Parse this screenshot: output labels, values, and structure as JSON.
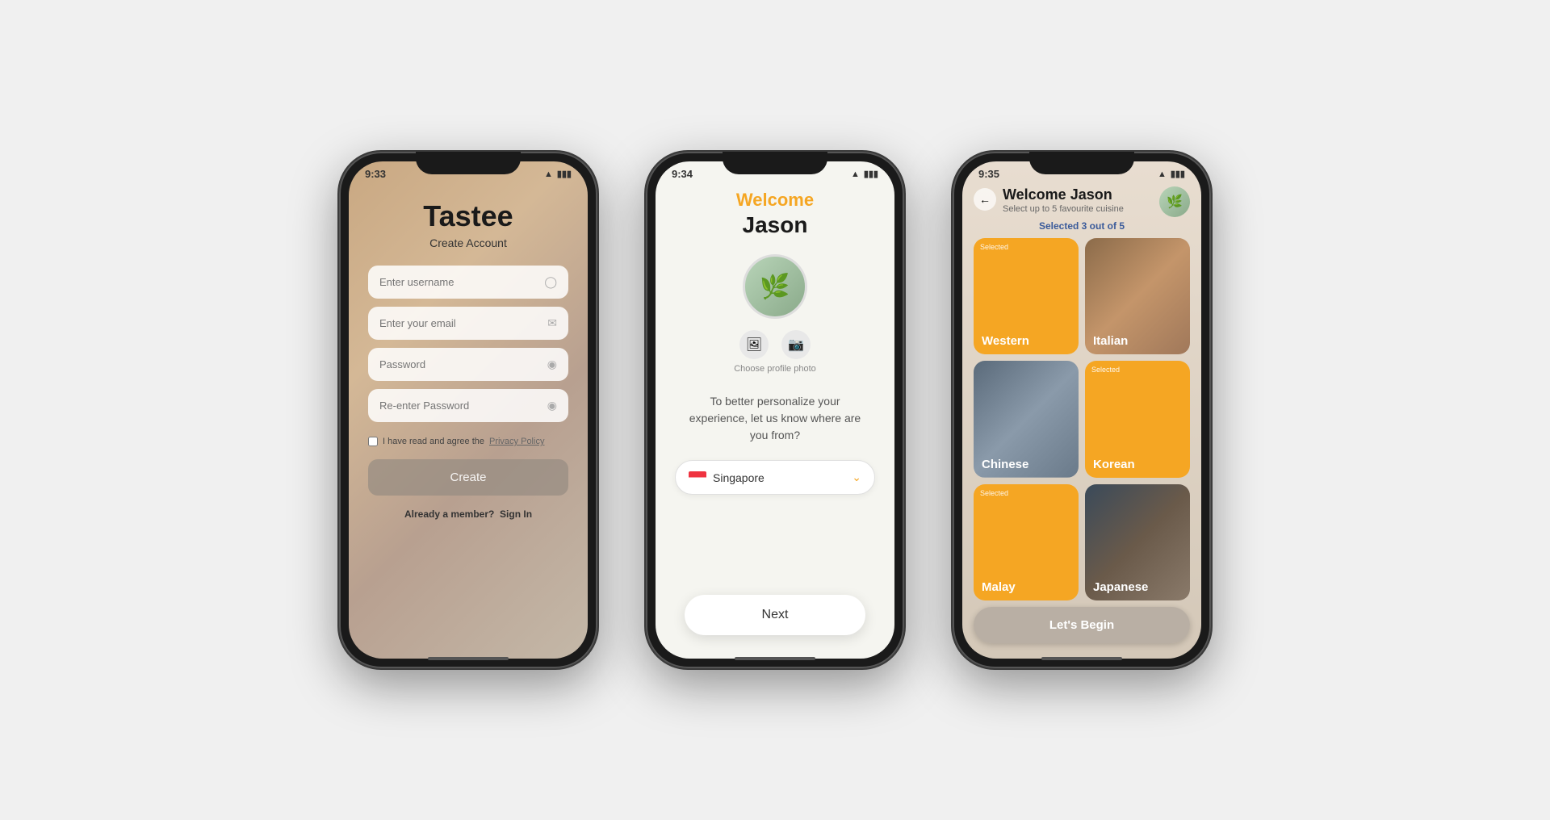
{
  "app": {
    "name": "Tastee"
  },
  "phone1": {
    "time": "9:33",
    "title": "Tastee",
    "subtitle": "Create Account",
    "username_placeholder": "Enter username",
    "email_placeholder": "Enter your email",
    "password_placeholder": "Password",
    "reenter_placeholder": "Re-enter Password",
    "checkbox_label": "I have read and agree the",
    "privacy_link": "Privacy Policy",
    "create_btn": "Create",
    "signin_text": "Already a member?",
    "signin_link": "Sign In"
  },
  "phone2": {
    "time": "9:34",
    "welcome_label": "Welcome",
    "user_name": "Jason",
    "choose_photo_label": "Choose profile photo",
    "personalize_text": "To better personalize your experience, let us know where are you from?",
    "country": "Singapore",
    "next_btn": "Next"
  },
  "phone3": {
    "time": "9:35",
    "welcome_text": "Welcome Jason",
    "subtitle": "Select up to 5 favourite cuisine",
    "selected_count": "Selected 3 out of 5",
    "cuisines": [
      {
        "name": "Western",
        "type": "selected",
        "label_small": "Selected"
      },
      {
        "name": "Italian",
        "type": "image"
      },
      {
        "name": "Chinese",
        "type": "image"
      },
      {
        "name": "Korean",
        "type": "selected",
        "label_small": "Selected"
      },
      {
        "name": "Malay",
        "type": "selected",
        "label_small": "Selected"
      },
      {
        "name": "Japanese",
        "type": "image"
      }
    ],
    "lets_begin_btn": "Let's Begin"
  }
}
